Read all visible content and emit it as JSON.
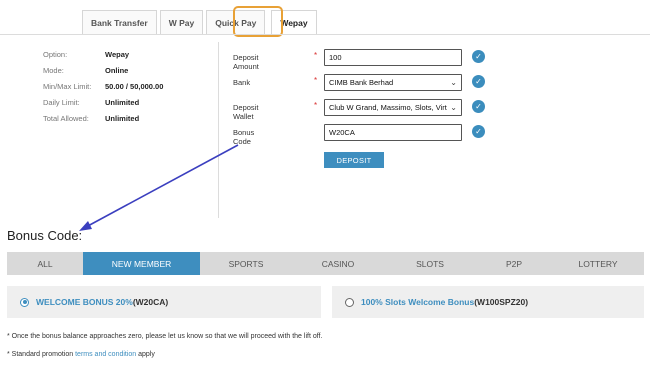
{
  "tabs": [
    {
      "label": "Bank Transfer",
      "active": false
    },
    {
      "label": "W Pay",
      "active": false
    },
    {
      "label": "Quick Pay",
      "active": false
    },
    {
      "label": "Wepay",
      "active": true
    }
  ],
  "info": [
    {
      "label": "Option:",
      "value": "Wepay"
    },
    {
      "label": "Mode:",
      "value": "Online"
    },
    {
      "label": "Min/Max Limit:",
      "value": "50.00 / 50,000.00"
    },
    {
      "label": "Daily Limit:",
      "value": "Unlimited"
    },
    {
      "label": "Total Allowed:",
      "value": "Unlimited"
    }
  ],
  "form": {
    "deposit_amount": {
      "label": "Deposit Amount",
      "value": "100"
    },
    "bank": {
      "label": "Bank",
      "value": "CIMB Bank Berhad"
    },
    "deposit_wallet": {
      "label": "Deposit Wallet",
      "value": "Club W Grand, Massimo, Slots, Virtu"
    },
    "bonus_code": {
      "label": "Bonus Code",
      "value": "W20CA"
    },
    "required_mark": "*",
    "check_glyph": "✓",
    "caret_glyph": "⌄",
    "deposit_button": "DEPOSIT"
  },
  "bonus": {
    "title": "Bonus Code:",
    "categories": [
      {
        "label": "ALL",
        "active": false
      },
      {
        "label": "NEW MEMBER",
        "active": true
      },
      {
        "label": "SPORTS",
        "active": false
      },
      {
        "label": "CASINO",
        "active": false
      },
      {
        "label": "SLOTS",
        "active": false
      },
      {
        "label": "P2P",
        "active": false
      },
      {
        "label": "LOTTERY",
        "active": false
      }
    ],
    "options": [
      {
        "name": "WELCOME BONUS 20%",
        "code": "(W20CA)",
        "selected": true
      },
      {
        "name": "100% Slots Welcome Bonus",
        "code": "(W100SPZ20)",
        "selected": false
      }
    ],
    "note1": "* Once the bonus balance approaches zero, please let us know so that we will proceed with the lift off.",
    "note2_prefix": "* Standard promotion ",
    "note2_link": "terms and condition",
    "note2_suffix": " apply"
  },
  "colors": {
    "accent": "#3e8ebf",
    "highlight": "#e8a136",
    "annotation_arrow": "#3b3fbf",
    "required": "#d93030"
  }
}
